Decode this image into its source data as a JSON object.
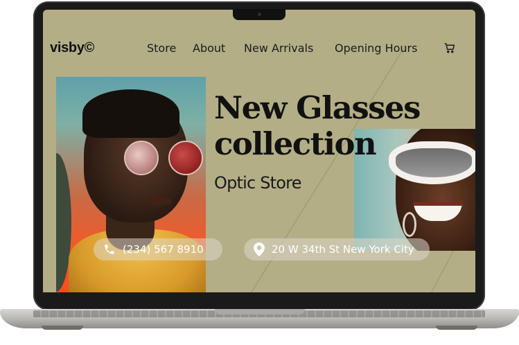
{
  "site": {
    "logo": "visby©",
    "nav": [
      "Store",
      "About",
      "New Arrivals",
      "Opening Hours"
    ],
    "cart_icon": "cart-icon"
  },
  "hero": {
    "headline_line1": "New Glasses",
    "headline_line2": "collection",
    "subheadline": "Optic Store"
  },
  "contact": {
    "phone": "(234) 567 8910",
    "phone_icon": "phone-icon",
    "address": "20 W 34th St New York City",
    "address_icon": "location-pin-icon"
  },
  "colors": {
    "background": "#b3ae86",
    "text": "#111111"
  }
}
